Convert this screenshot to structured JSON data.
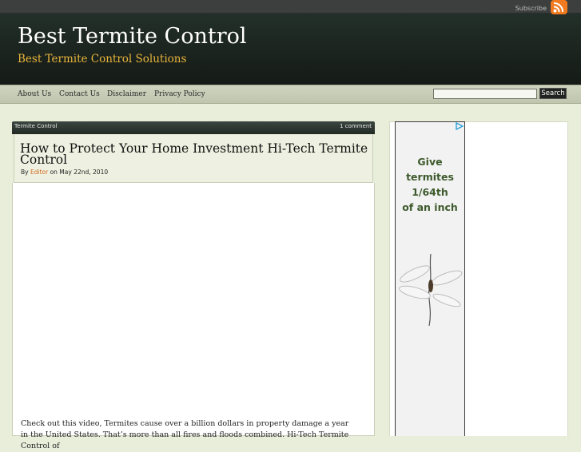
{
  "header": {
    "subscribe": "Subscribe",
    "site_title": "Best Termite Control",
    "tagline": "Best Termite Control Solutions"
  },
  "nav": {
    "items": [
      "About Us",
      "Contact Us",
      "Disclaimer",
      "Privacy Policy"
    ],
    "search_placeholder": "",
    "search_button": "Search"
  },
  "post": {
    "category": "Termite Control",
    "comments": "1 comment",
    "title": "How to Protect Your Home Investment Hi-Tech Termite Control",
    "meta_by": "By",
    "author": "Editor",
    "meta_date": "on May 22nd, 2010",
    "excerpt": "Check out this video, Termites cause over a billion dollars in property damage a year in the United States. That’s more than all fires and floods combined. Hi-Tech Termite Control of"
  },
  "ad": {
    "lines": [
      "Give",
      "termites",
      "1/64th",
      "of an inch"
    ]
  },
  "colors": {
    "accent": "#e8b43a",
    "author_link": "#d2691e",
    "rss": "#f07a1f",
    "ad_text": "#3d5a2c"
  }
}
